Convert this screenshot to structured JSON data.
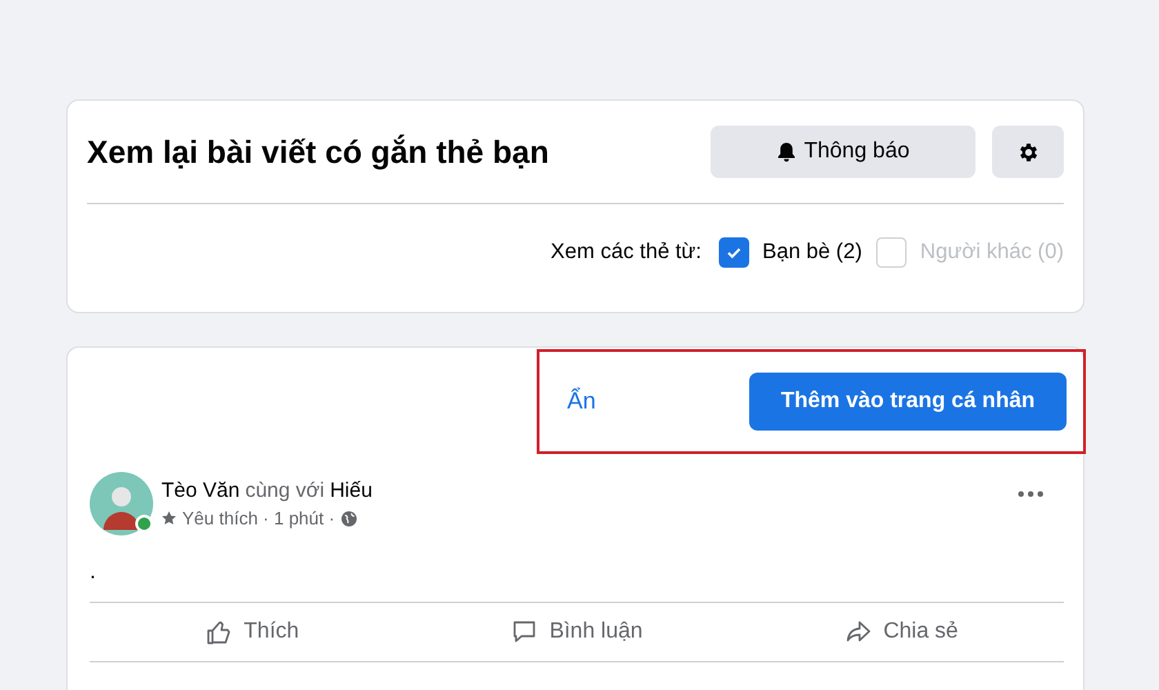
{
  "review": {
    "title": "Xem lại bài viết có gắn thẻ bạn",
    "notify_button": "Thông báo",
    "filter_label": "Xem các thẻ từ:",
    "filters": [
      {
        "label": "Bạn bè (2)",
        "checked": true,
        "disabled": false
      },
      {
        "label": "Người khác (0)",
        "checked": false,
        "disabled": true
      }
    ]
  },
  "post": {
    "hide_link": "Ẩn",
    "add_button": "Thêm vào trang cá nhân",
    "author": "Tèo Văn",
    "connector": "cùng với",
    "tagged": "Hiếu",
    "online": true,
    "meta": "Yêu thích · 1 phút ·",
    "body": ".",
    "actions": [
      {
        "kind": "like",
        "label": "Thích"
      },
      {
        "kind": "comment",
        "label": "Bình luận"
      },
      {
        "kind": "share",
        "label": "Chia sẻ"
      }
    ]
  }
}
